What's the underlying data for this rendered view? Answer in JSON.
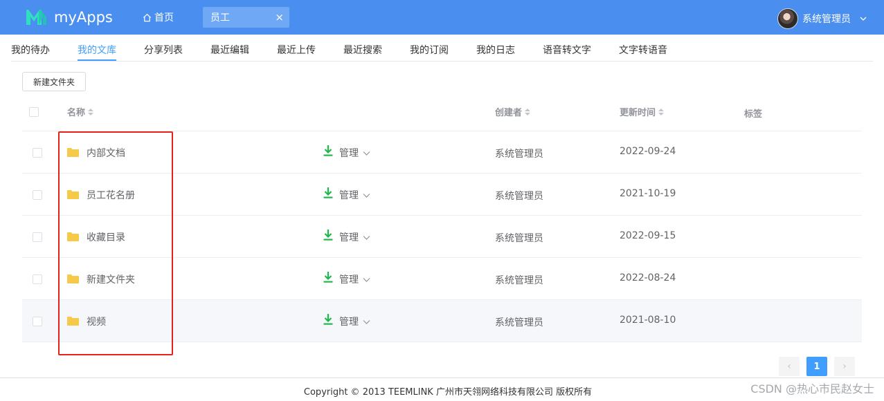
{
  "app": {
    "name": "myApps"
  },
  "header": {
    "home_tab": "首页",
    "open_tab": "员工",
    "close_glyph": "×",
    "user_name": "系统管理员"
  },
  "subnav": {
    "items": [
      "我的待办",
      "我的文库",
      "分享列表",
      "最近编辑",
      "最近上传",
      "最近搜索",
      "我的订阅",
      "我的日志",
      "语音转文字",
      "文字转语音"
    ],
    "active_index": 1
  },
  "toolbar": {
    "new_folder": "新建文件夹"
  },
  "table": {
    "columns": {
      "name": "名称",
      "creator": "创建者",
      "updated": "更新时间",
      "tags": "标签"
    },
    "rows": [
      {
        "name": "内部文档",
        "manage": "管理",
        "creator": "系统管理员",
        "updated": "2022-09-24"
      },
      {
        "name": "员工花名册",
        "manage": "管理",
        "creator": "系统管理员",
        "updated": "2021-10-19"
      },
      {
        "name": "收藏目录",
        "manage": "管理",
        "creator": "系统管理员",
        "updated": "2022-09-15"
      },
      {
        "name": "新建文件夹",
        "manage": "管理",
        "creator": "系统管理员",
        "updated": "2022-08-24"
      },
      {
        "name": "视频",
        "manage": "管理",
        "creator": "系统管理员",
        "updated": "2021-08-10"
      }
    ]
  },
  "pagination": {
    "prev": "‹",
    "current": "1",
    "next": "›"
  },
  "footer": {
    "copyright": "Copyright © 2013 TEEMLINK 广州市天翎网络科技有限公司 版权所有"
  },
  "watermark": "CSDN @热心市民赵女士",
  "colors": {
    "header_bg": "#4a8ff0",
    "accent": "#409eff",
    "highlight": "#e3231b",
    "download": "#1eb84a",
    "folder": "#f7c948"
  }
}
